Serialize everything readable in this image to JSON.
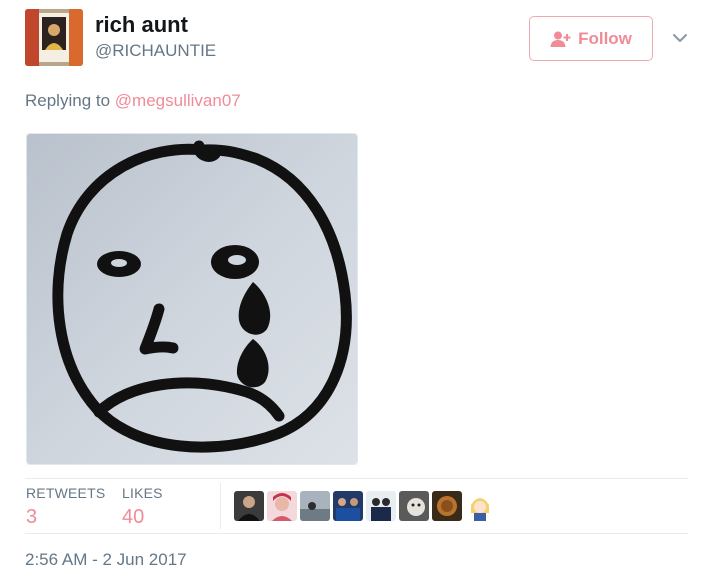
{
  "author": {
    "display_name": "rich aunt",
    "handle": "@RICHAUNTIE",
    "avatar_icon": "profile-photo"
  },
  "follow_button": {
    "label": "Follow",
    "icon": "add-person-icon",
    "color": "#f08b98"
  },
  "menu": {
    "icon": "chevron-down-icon"
  },
  "reply": {
    "prefix": "Replying to",
    "mention": "@megsullivan07"
  },
  "media": {
    "description_icon": "sad-crying-face-drawing"
  },
  "stats": {
    "retweets_label": "RETWEETS",
    "retweets_count": "3",
    "likes_label": "LIKES",
    "likes_count": "40"
  },
  "likers": [
    {
      "icon": "liker-avatar-1"
    },
    {
      "icon": "liker-avatar-2"
    },
    {
      "icon": "liker-avatar-3"
    },
    {
      "icon": "liker-avatar-4"
    },
    {
      "icon": "liker-avatar-5"
    },
    {
      "icon": "liker-avatar-6"
    },
    {
      "icon": "liker-avatar-7"
    },
    {
      "icon": "liker-avatar-8"
    }
  ],
  "timestamp": "2:56 AM - 2 Jun 2017",
  "colors": {
    "accent": "#f08b98",
    "secondary_text": "#657786",
    "primary_text": "#14171a"
  }
}
